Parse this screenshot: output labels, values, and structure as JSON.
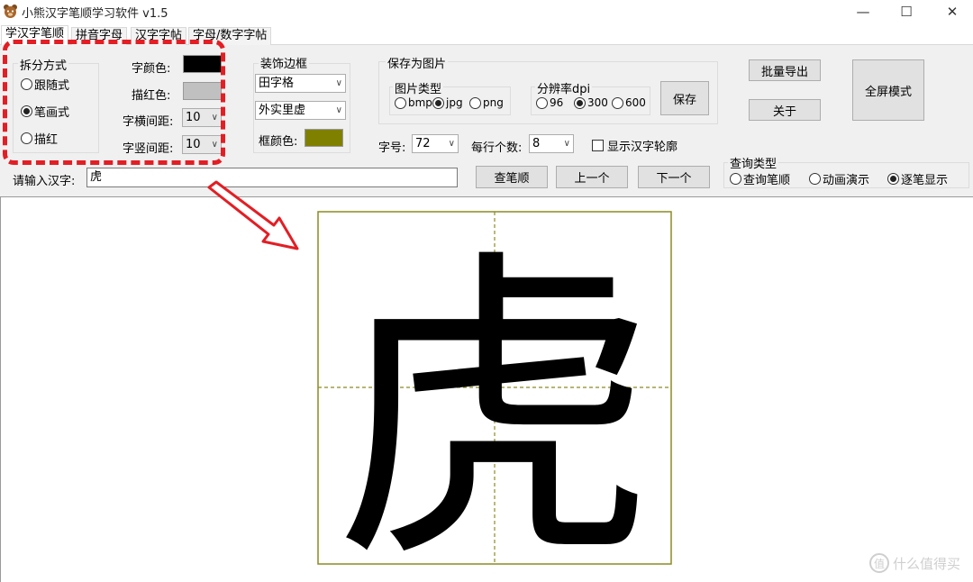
{
  "window": {
    "title": "小熊汉字笔顺学习软件 v1.5",
    "minimize": "—",
    "maximize": "☐",
    "close": "✕"
  },
  "tabs": [
    {
      "label": "学汉字笔顺",
      "active": true
    },
    {
      "label": "拼音字母",
      "active": false
    },
    {
      "label": "汉字字帖",
      "active": false
    },
    {
      "label": "字母/数字字帖",
      "active": false
    }
  ],
  "split_mode": {
    "title": "拆分方式",
    "options": [
      {
        "label": "跟随式",
        "selected": false
      },
      {
        "label": "笔画式",
        "selected": true
      },
      {
        "label": "描红",
        "selected": false
      }
    ]
  },
  "style": {
    "font_color_label": "字颜色:",
    "font_color": "#000000",
    "trace_color_label": "描红色:",
    "trace_color": "#c0c0c0",
    "h_spacing_label": "字横间距:",
    "h_spacing": "10",
    "v_spacing_label": "字竖间距:",
    "v_spacing": "10"
  },
  "border": {
    "title": "装饰边框",
    "grid_type": "田字格",
    "frame_style": "外实里虚",
    "frame_color_label": "框颜色:",
    "frame_color": "#808000"
  },
  "save_image": {
    "title": "保存为图片",
    "type_title": "图片类型",
    "types": [
      {
        "label": "bmp",
        "selected": false
      },
      {
        "label": "jpg",
        "selected": true
      },
      {
        "label": "png",
        "selected": false
      }
    ],
    "dpi_title": "分辨率dpi",
    "dpis": [
      {
        "label": "96",
        "selected": false
      },
      {
        "label": "300",
        "selected": true
      },
      {
        "label": "600",
        "selected": false
      }
    ],
    "save_button": "保存"
  },
  "font_size": {
    "label": "字号:",
    "value": "72"
  },
  "per_row": {
    "label": "每行个数:",
    "value": "8"
  },
  "show_outline": {
    "label": "显示汉字轮廓",
    "checked": false
  },
  "buttons": {
    "batch_export": "批量导出",
    "about": "关于",
    "fullscreen": "全屏模式",
    "lookup": "查笔顺",
    "prev": "上一个",
    "next": "下一个"
  },
  "input": {
    "label": "请输入汉字:",
    "value": "虎"
  },
  "query_type": {
    "title": "查询类型",
    "options": [
      {
        "label": "查询笔顺",
        "selected": false
      },
      {
        "label": "动画演示",
        "selected": false
      },
      {
        "label": "逐笔显示",
        "selected": true
      }
    ]
  },
  "display": {
    "character": "虎",
    "grid_color": "#8b8b22"
  },
  "watermark": {
    "icon": "值",
    "text": "什么值得买"
  }
}
